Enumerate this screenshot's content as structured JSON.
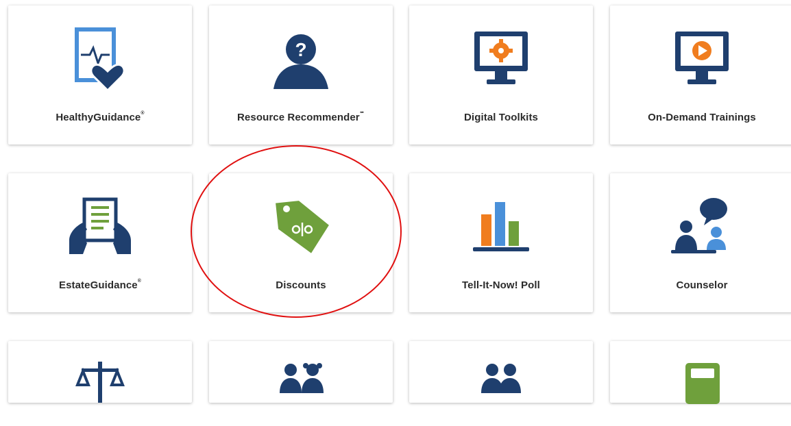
{
  "tiles": [
    {
      "label": "HealthyGuidance",
      "mark": "®"
    },
    {
      "label": "Resource Recommender",
      "mark": "℠"
    },
    {
      "label": "Digital Toolkits",
      "mark": ""
    },
    {
      "label": "On-Demand Trainings",
      "mark": ""
    },
    {
      "label": "EstateGuidance",
      "mark": "®"
    },
    {
      "label": "Discounts",
      "mark": ""
    },
    {
      "label": "Tell-It-Now! Poll",
      "mark": ""
    },
    {
      "label": "Counselor",
      "mark": ""
    }
  ],
  "colors": {
    "navy": "#1f3f6e",
    "blue": "#4a90d9",
    "green": "#6fa03c",
    "orange": "#f07d1f",
    "annotation": "#e01010"
  }
}
